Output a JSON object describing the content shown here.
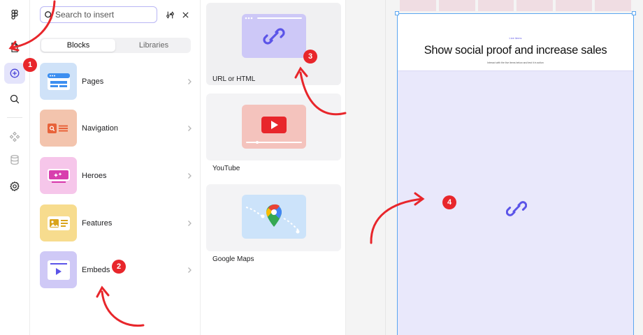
{
  "search": {
    "placeholder": "Search to insert"
  },
  "tabs": {
    "blocks": "Blocks",
    "libraries": "Libraries"
  },
  "categories": [
    {
      "label": "Pages",
      "color": "#cfe2f8"
    },
    {
      "label": "Navigation",
      "color": "#f3c4ad"
    },
    {
      "label": "Heroes",
      "color": "#f6c6ea"
    },
    {
      "label": "Features",
      "color": "#f7dc8e"
    },
    {
      "label": "Embeds",
      "color": "#cfc9f6"
    }
  ],
  "embeds": [
    {
      "label": "URL or HTML",
      "icon": "link-icon"
    },
    {
      "label": "YouTube",
      "icon": "youtube-play-icon"
    },
    {
      "label": "Google Maps",
      "icon": "map-pin-icon"
    }
  ],
  "frame": {
    "eyebrow": "Live items",
    "title": "Show social proof and increase sales",
    "subtitle": "Interact with the live items below and test it in action"
  },
  "badges": [
    "1",
    "2",
    "3",
    "4"
  ],
  "colors": {
    "accent": "#5b54e8",
    "annotation": "#e8262b",
    "selection": "#5aa6f0"
  }
}
